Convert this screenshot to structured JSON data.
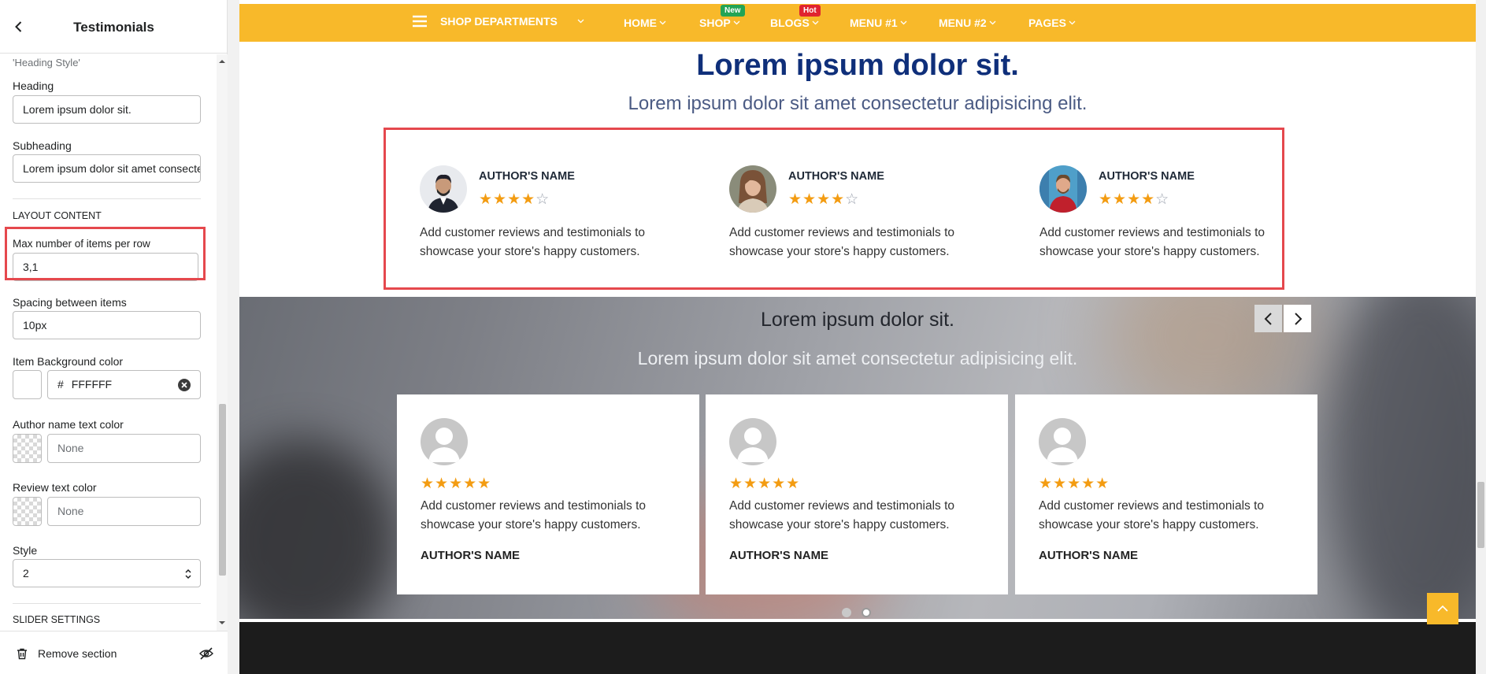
{
  "panel": {
    "title": "Testimonials",
    "cut_label": "'Heading Style'",
    "heading_label": "Heading",
    "heading_value": "Lorem ipsum dolor sit.",
    "subheading_label": "Subheading",
    "subheading_value": "Lorem ipsum dolor sit amet consectetur adipisicing elit.",
    "layout_section": "LAYOUT CONTENT",
    "max_items_label": "Max number of items per row",
    "max_items_value": "3,1",
    "spacing_label": "Spacing between items",
    "spacing_value": "10px",
    "item_bg_label": "Item Background color",
    "item_bg_hash": "#",
    "item_bg_value": "FFFFFF",
    "author_color_label": "Author name text color",
    "author_color_value": "None",
    "review_color_label": "Review text color",
    "review_color_value": "None",
    "style_label": "Style",
    "style_value": "2",
    "slider_section": "SLIDER SETTINGS",
    "remove_label": "Remove section"
  },
  "nav": {
    "departments": "SHOP DEPARTMENTS",
    "home": "HOME",
    "shop": "SHOP",
    "shop_badge": "New",
    "blogs": "BLOGS",
    "blogs_badge": "Hot",
    "menu1": "MENU #1",
    "menu2": "MENU #2",
    "pages": "PAGES"
  },
  "section1": {
    "heading": "Lorem ipsum dolor sit.",
    "subheading": "Lorem ipsum dolor sit amet consectetur adipisicing elit.",
    "items": [
      {
        "name": "AUTHOR'S NAME",
        "rating": 4,
        "review": "Add customer reviews and testimonials to showcase your store's happy customers."
      },
      {
        "name": "AUTHOR'S NAME",
        "rating": 4,
        "review": "Add customer reviews and testimonials to showcase your store's happy customers."
      },
      {
        "name": "AUTHOR'S NAME",
        "rating": 4,
        "review": "Add customer reviews and testimonials to showcase your store's happy customers."
      }
    ]
  },
  "section2": {
    "heading": "Lorem ipsum dolor sit.",
    "subheading": "Lorem ipsum dolor sit amet consectetur adipisicing elit.",
    "items": [
      {
        "name": "AUTHOR'S NAME",
        "rating": 5,
        "review": "Add customer reviews and testimonials to showcase your store's happy customers."
      },
      {
        "name": "AUTHOR'S NAME",
        "rating": 5,
        "review": "Add customer reviews and testimonials to showcase your store's happy customers."
      },
      {
        "name": "AUTHOR'S NAME",
        "rating": 5,
        "review": "Add customer reviews and testimonials to showcase your store's happy customers."
      }
    ],
    "pager_count": 2,
    "pager_active": 2
  },
  "colors": {
    "nav_bg": "#F8B92A",
    "heading": "#0F2F7A",
    "highlight": "#E5484D",
    "star": "#F39C12",
    "footer_bg": "#1C1C1C"
  }
}
